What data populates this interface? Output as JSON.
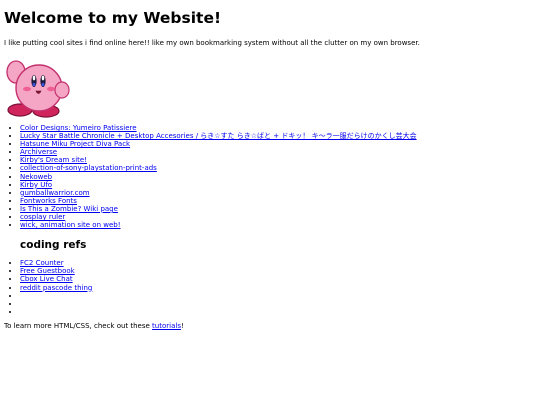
{
  "header": {
    "title": "Welcome to my Website!"
  },
  "intro": {
    "text": "I like putting cool sites i find online here!! like my own bookmarking system without all the clutter on my own browser."
  },
  "links": [
    {
      "label": "Color Designs: Yumeiro Patissiere"
    },
    {
      "label": "Lucky Star Battle Chronicle + Desktop Accesories / らき☆すた らき☆ばと + ドキッ！ キ～ラ一服だらけのかくし芸大会"
    },
    {
      "label": "Hatsune Miku Project Diva Pack"
    },
    {
      "label": "Archiverse"
    },
    {
      "label": "Kirby's Dream site!"
    },
    {
      "label": "collection-of-sony-playstation-print-ads"
    },
    {
      "label": "Nekoweb"
    },
    {
      "label": "Kirby Ufo"
    },
    {
      "label": "gumballwarrior.com"
    },
    {
      "label": "Fontworks Fonts"
    },
    {
      "label": "Is This a Zombie? Wiki page"
    },
    {
      "label": "cosplay ruler"
    },
    {
      "label": "wick, animation site on web!"
    }
  ],
  "coding_refs": {
    "title": "coding refs",
    "items": [
      {
        "label": "FC2 Counter"
      },
      {
        "label": "Free Guestbook"
      },
      {
        "label": "Cbox Live Chat"
      },
      {
        "label": "reddit pascode thing"
      },
      {
        "label": ""
      },
      {
        "label": ""
      },
      {
        "label": ""
      }
    ]
  },
  "footer": {
    "prefix": "To learn more HTML/CSS, check out these ",
    "link": "tutorials",
    "suffix": "!"
  },
  "image": {
    "icon": "kirby-icon",
    "colors": {
      "body": "#f4a6c4",
      "outline": "#c4306e",
      "feet": "#d0245c",
      "cheek": "#ee5f93"
    }
  }
}
